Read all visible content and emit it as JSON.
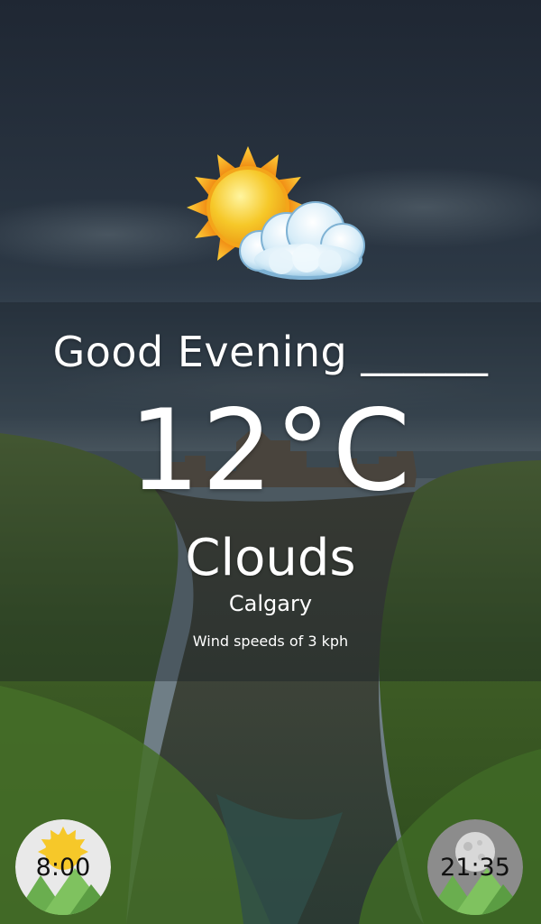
{
  "weather": {
    "greeting": "Good Evening ______",
    "temperature": "12°C",
    "condition": "Clouds",
    "city": "Calgary",
    "wind": "Wind speeds of 3 kph",
    "icon": "sun-behind-cloud-icon"
  },
  "sunrise": {
    "time": "8:00",
    "icon": "sun-over-mountains-icon"
  },
  "sunset": {
    "time": "21:35",
    "icon": "moon-over-mountains-icon"
  },
  "colors": {
    "sky": "#2a3440",
    "grass": "#4c7a2c",
    "sun": "#f6c829",
    "mountain": "#6aae4f",
    "badge_bg": "#e9e9e9",
    "moon_badge_bg": "#8c8c8c"
  }
}
